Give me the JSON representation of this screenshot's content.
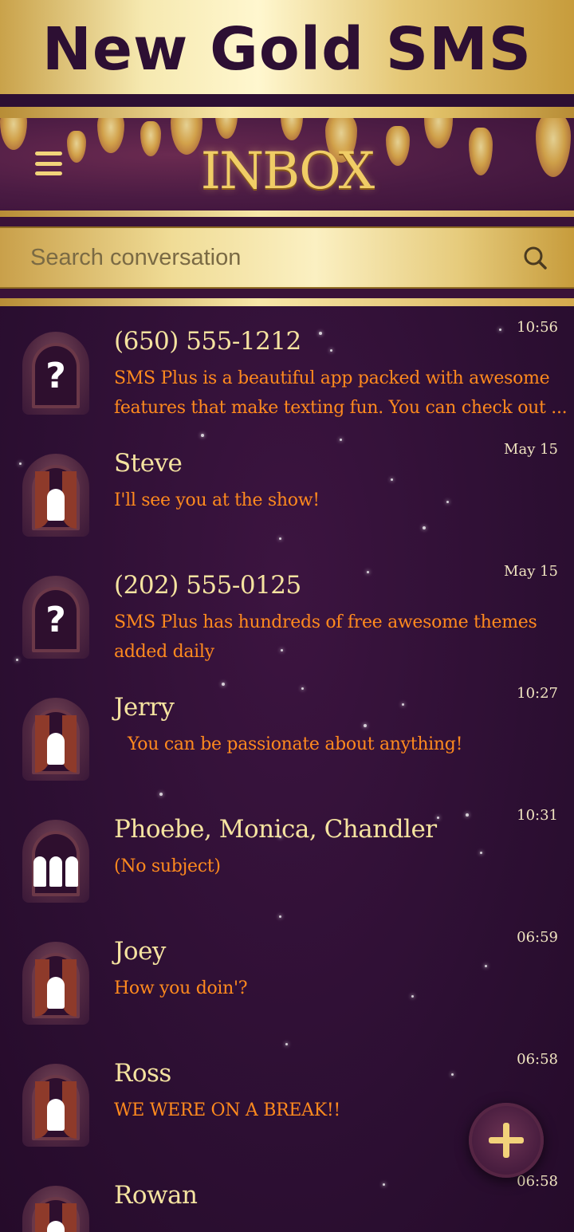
{
  "banner": {
    "title": "New Gold SMS"
  },
  "header": {
    "title": "INBOX"
  },
  "search": {
    "placeholder": "Search conversation"
  },
  "conversations": [
    {
      "name": "(650) 555-1212",
      "time": "10:56",
      "snippet": "SMS Plus is a beautiful app packed with awesome features that make texting fun. You can check out ...",
      "avatar": "unknown-contact"
    },
    {
      "name": "Steve",
      "time": "May 15",
      "snippet": "I'll see you at the show!",
      "avatar": "contact"
    },
    {
      "name": "(202) 555-0125",
      "time": "May 15",
      "snippet": "SMS Plus has hundreds of free awesome themes added daily",
      "avatar": "unknown-contact"
    },
    {
      "name": "Jerry",
      "time": "10:27",
      "snippet": "You can be passionate about anything!",
      "avatar": "contact"
    },
    {
      "name": "Phoebe, Monica, Chandler",
      "time": "10:31",
      "snippet": "(No subject)",
      "avatar": "group"
    },
    {
      "name": "Joey",
      "time": "06:59",
      "snippet": "How you doin'?",
      "avatar": "contact"
    },
    {
      "name": "Ross",
      "time": "06:58",
      "snippet": "WE WERE ON A BREAK!!",
      "avatar": "contact"
    },
    {
      "name": "Rowan",
      "time": "06:58",
      "snippet": "",
      "avatar": "contact"
    }
  ],
  "icons": {
    "menu": "hamburger-icon",
    "search": "search-icon",
    "compose": "plus-icon"
  },
  "colors": {
    "background": "#2d0f33",
    "gold": "#f0cd66",
    "name": "#f5e3a0",
    "snippet": "#ff8a1e"
  }
}
